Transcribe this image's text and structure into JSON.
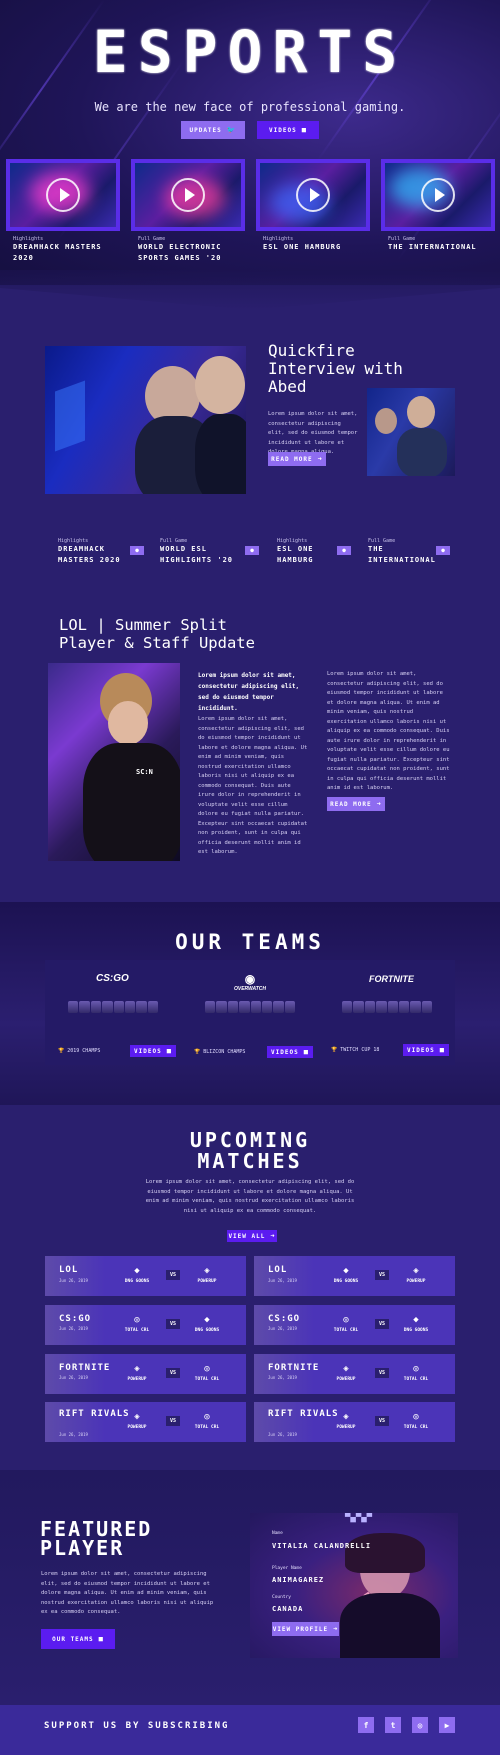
{
  "hero": {
    "title": "ESPORTS",
    "subtitle": "We are the new face of professional gaming.",
    "buttons": {
      "updates": "UPDATES",
      "videos": "VIDEOS"
    },
    "videos": [
      {
        "kicker": "Highlights",
        "title": "DREAMHACK MASTERS 2020"
      },
      {
        "kicker": "Full Game",
        "title": "WORLD ELECTRONIC SPORTS GAMES '20"
      },
      {
        "kicker": "Highlights",
        "title": "ESL ONE HAMBURG"
      },
      {
        "kicker": "Full Game",
        "title": "THE INTERNATIONAL"
      }
    ]
  },
  "interview": {
    "title": "Quickfire Interview with Abed",
    "body": "Lorem ipsum dolor sit amet, consectetur adipiscing elit, sed do eiusmod tempor incididunt ut labore et dolore magna aliqua.",
    "button": "READ MORE",
    "links": [
      {
        "kicker": "Highlights",
        "title": "DREAMHACK MASTERS 2020"
      },
      {
        "kicker": "Full Game",
        "title": "WORLD ESL HIGHLIGHTS '20"
      },
      {
        "kicker": "Highlights",
        "title": "ESL ONE HAMBURG"
      },
      {
        "kicker": "Full Game",
        "title": "THE INTERNATIONAL"
      }
    ]
  },
  "update": {
    "title": "LOL | Summer Split Player & Staff Update",
    "lead": "Lorem ipsum dolor sit amet, consectetur adipiscing elit, sed do eiusmod tempor incididunt.",
    "col1": "Lorem ipsum dolor sit amet, consectetur adipiscing elit, sed do eiusmod tempor incididunt ut labore et dolore magna aliqua. Ut enim ad minim veniam, quis nostrud exercitation ullamco laboris nisi ut aliquip ex ea commodo consequat. Duis aute irure dolor in reprehenderit in voluptate velit esse cillum dolore eu fugiat nulla pariatur. Excepteur sint occaecat cupidatat non proident, sunt in culpa qui officia deserunt mollit anim id est laborum.",
    "col2": "Lorem ipsum dolor sit amet, consectetur adipiscing elit, sed do eiusmod tempor incididunt ut labore et dolore magna aliqua. Ut enim ad minim veniam, quis nostrud exercitation ullamco laboris nisi ut aliquip ex ea commodo consequat. Duis aute irure dolor in reprehenderit in voluptate velit esse cillum dolore eu fugiat nulla pariatur. Excepteur sint occaecat cupidatat non proident, sunt in culpa qui officia deserunt mollit anim id est laborum.",
    "button": "READ MORE"
  },
  "teams": {
    "title": "OUR TEAMS",
    "list": [
      {
        "logo": "CS:GO",
        "champ": "2019 CHAMPS",
        "button": "VIDEOS"
      },
      {
        "logo": "OVERWATCH",
        "champ": "BLIZCON CHAMPS",
        "button": "VIDEOS"
      },
      {
        "logo": "FORTNITE",
        "champ": "TWITCH CUP 18",
        "button": "VIDEOS"
      }
    ]
  },
  "matches": {
    "title_line1": "UPCOMING",
    "title_line2": "MATCHES",
    "intro": "Lorem ipsum dolor sit amet, consectetur adipiscing elit, sed do eiusmod tempor incididunt ut labore et dolore magna aliqua. Ut enim ad minim veniam, quis nostrud exercitation ullamco laboris nisi ut aliquip ex ea commodo consequat.",
    "button": "VIEW ALL",
    "vs": "VS",
    "cards": [
      {
        "game": "LOL",
        "date": "Jun 26, 2019",
        "team1": "DNG GOONS",
        "team2": "POWERUP"
      },
      {
        "game": "LOL",
        "date": "Jun 26, 2019",
        "team1": "DNG GOONS",
        "team2": "POWERUP"
      },
      {
        "game": "CS:GO",
        "date": "Jun 26, 2019",
        "team1": "TOTAL CRL",
        "team2": "DNG GOONS"
      },
      {
        "game": "CS:GO",
        "date": "Jun 26, 2019",
        "team1": "TOTAL CRL",
        "team2": "DNG GOONS"
      },
      {
        "game": "FORTNITE",
        "date": "Jun 26, 2019",
        "team1": "POWERUP",
        "team2": "TOTAL CRL"
      },
      {
        "game": "FORTNITE",
        "date": "Jun 26, 2019",
        "team1": "POWERUP",
        "team2": "TOTAL CRL"
      },
      {
        "game": "RIFT RIVALS",
        "date": "Jun 26, 2019",
        "team1": "POWERUP",
        "team2": "TOTAL CRL"
      },
      {
        "game": "RIFT RIVALS",
        "date": "Jun 26, 2019",
        "team1": "POWERUP",
        "team2": "TOTAL CRL"
      }
    ]
  },
  "featured": {
    "title_line1": "FEATURED",
    "title_line2": "PLAYER",
    "body": "Lorem ipsum dolor sit amet, consectetur adipiscing elit, sed do eiusmod tempor incididunt ut labore et dolore magna aliqua. Ut enim ad minim veniam, quis nostrud exercitation ullamco laboris nisi ut aliquip ex ea commodo consequat.",
    "button": "OUR TEAMS",
    "name_label": "Name",
    "name": "VITALIA CALANDRELLI",
    "player_label": "Player Name",
    "player": "ANIMAGAREZ",
    "country_label": "Country",
    "country": "CANADA",
    "profile_button": "VIEW PROFILE"
  },
  "footer": {
    "text": "SUPPORT US BY SUBSCRIBING",
    "socials": [
      "facebook-icon",
      "twitter-icon",
      "instagram-icon",
      "youtube-icon"
    ]
  }
}
